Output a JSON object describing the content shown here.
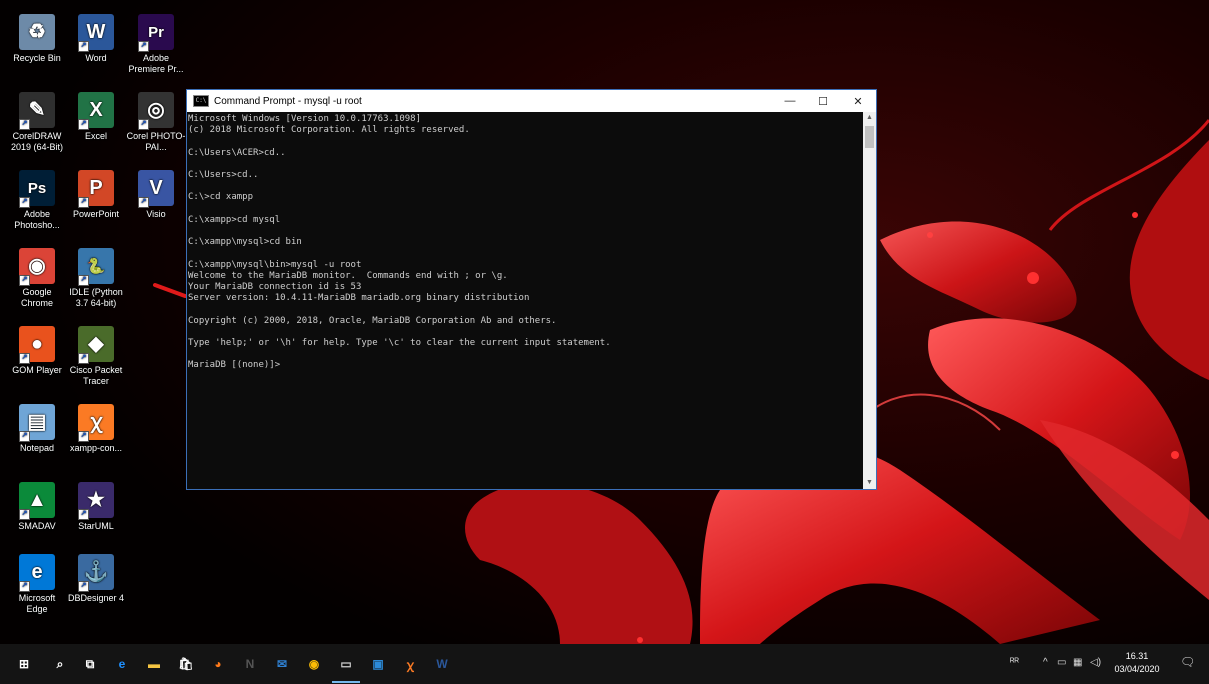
{
  "desktop_icons": [
    {
      "label": "Recycle Bin",
      "icon": "recycle-bin-icon",
      "color": "#6d8aa8",
      "glyph": "♻"
    },
    {
      "label": "Word",
      "icon": "word-icon",
      "color": "#2b579a",
      "glyph": "W"
    },
    {
      "label": "Adobe Premiere Pr...",
      "icon": "premiere-icon",
      "color": "#2a0a4e",
      "glyph": "Pr"
    },
    {
      "label": "CorelDRAW 2019 (64-Bit)",
      "icon": "coreldraw-icon",
      "color": "#2f2f2f",
      "glyph": "✎"
    },
    {
      "label": "Excel",
      "icon": "excel-icon",
      "color": "#217346",
      "glyph": "X"
    },
    {
      "label": "Corel PHOTO-PAI...",
      "icon": "corel-photopaint-icon",
      "color": "#333333",
      "glyph": "◎"
    },
    {
      "label": "Adobe Photosho...",
      "icon": "photoshop-icon",
      "color": "#001e36",
      "glyph": "Ps"
    },
    {
      "label": "PowerPoint",
      "icon": "powerpoint-icon",
      "color": "#d24726",
      "glyph": "P"
    },
    {
      "label": "Visio",
      "icon": "visio-icon",
      "color": "#3955a3",
      "glyph": "V"
    },
    {
      "label": "Google Chrome",
      "icon": "chrome-icon",
      "color": "#db4437",
      "glyph": "◉"
    },
    {
      "label": "IDLE (Python 3.7 64-bit)",
      "icon": "python-idle-icon",
      "color": "#3776ab",
      "glyph": "🐍"
    },
    {
      "label": "GOM Player",
      "icon": "gom-player-icon",
      "color": "#e9521d",
      "glyph": "●"
    },
    {
      "label": "Cisco Packet Tracer",
      "icon": "packet-tracer-icon",
      "color": "#4a6b2a",
      "glyph": "◆"
    },
    {
      "label": "Notepad",
      "icon": "notepad-icon",
      "color": "#6fa5d6",
      "glyph": "▤"
    },
    {
      "label": "xampp-con...",
      "icon": "xampp-icon",
      "color": "#fb7a24",
      "glyph": "ꭓ"
    },
    {
      "label": "SMADAV",
      "icon": "smadav-icon",
      "color": "#0b8a3a",
      "glyph": "▲"
    },
    {
      "label": "StarUML",
      "icon": "staruml-icon",
      "color": "#3a2a6a",
      "glyph": "★"
    },
    {
      "label": "Microsoft Edge",
      "icon": "edge-icon",
      "color": "#0078d7",
      "glyph": "e"
    },
    {
      "label": "DBDesigner 4",
      "icon": "dbdesigner-icon",
      "color": "#3a6aa0",
      "glyph": "⚓"
    }
  ],
  "cmd_window": {
    "title": "Command Prompt - mysql  -u root",
    "title_icon": "C:\\",
    "minimize": "—",
    "maximize": "☐",
    "close": "✕",
    "lines": [
      "Microsoft Windows [Version 10.0.17763.1098]",
      "(c) 2018 Microsoft Corporation. All rights reserved.",
      "",
      "C:\\Users\\ACER>cd..",
      "",
      "C:\\Users>cd..",
      "",
      "C:\\>cd xampp",
      "",
      "C:\\xampp>cd mysql",
      "",
      "C:\\xampp\\mysql>cd bin",
      "",
      "C:\\xampp\\mysql\\bin>mysql -u root",
      "Welcome to the MariaDB monitor.  Commands end with ; or \\g.",
      "Your MariaDB connection id is 53",
      "Server version: 10.4.11-MariaDB mariadb.org binary distribution",
      "",
      "Copyright (c) 2000, 2018, Oracle, MariaDB Corporation Ab and others.",
      "",
      "Type 'help;' or '\\h' for help. Type '\\c' to clear the current input statement.",
      "",
      "MariaDB [(none)]>"
    ]
  },
  "taskbar": {
    "items": [
      {
        "name": "start-icon",
        "glyph": "⊞",
        "color": "#ffffff"
      },
      {
        "name": "search-icon",
        "glyph": "⌕",
        "color": "#ffffff"
      },
      {
        "name": "task-view-icon",
        "glyph": "⧉",
        "color": "#ffffff"
      },
      {
        "name": "edge-taskbar-icon",
        "glyph": "e",
        "color": "#1e90ff"
      },
      {
        "name": "file-explorer-icon",
        "glyph": "▬",
        "color": "#f5c542"
      },
      {
        "name": "store-icon",
        "glyph": "🛍",
        "color": "#ffffff"
      },
      {
        "name": "firefox-icon",
        "glyph": "◕",
        "color": "#ff7a1a"
      },
      {
        "name": "onenote-icon",
        "glyph": "N",
        "color": "#555555"
      },
      {
        "name": "mail-icon",
        "glyph": "✉",
        "color": "#2f80d1"
      },
      {
        "name": "chrome-taskbar-icon",
        "glyph": "◉",
        "color": "#fbbc05"
      },
      {
        "name": "cmd-taskbar-icon",
        "glyph": "▭",
        "color": "#cccccc"
      },
      {
        "name": "photos-taskbar-icon",
        "glyph": "▣",
        "color": "#2c8ad8"
      },
      {
        "name": "xampp-taskbar-icon",
        "glyph": "ꭓ",
        "color": "#fb7a24"
      },
      {
        "name": "word-taskbar-icon",
        "glyph": "W",
        "color": "#2b579a"
      }
    ],
    "tray": {
      "people": "ᴿᴿ",
      "chevron": "^",
      "battery": "▭",
      "network": "▦",
      "volume": "◁)",
      "time": "16.31",
      "date": "03/04/2020",
      "notifications": "🗨"
    }
  }
}
